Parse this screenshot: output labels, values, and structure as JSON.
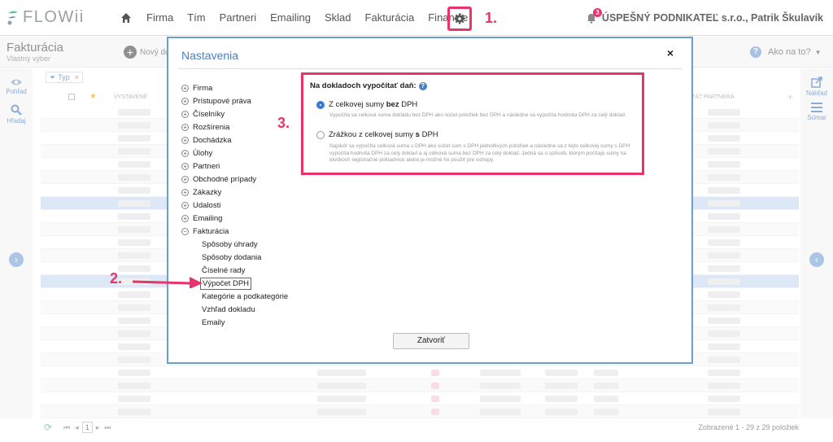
{
  "app": {
    "logo_text": "FLOWii"
  },
  "nav": {
    "items": [
      "Firma",
      "Tím",
      "Partneri",
      "Emailing",
      "Sklad",
      "Fakturácia",
      "Financie"
    ]
  },
  "user": {
    "company": "ÚSPEŠNÝ PODNIKATEĽ s.r.o., Patrik Škulavík",
    "notification_count": "3"
  },
  "annotations": {
    "step1": "1.",
    "step2": "2.",
    "step3": "3.",
    "accent_color": "#e8336b"
  },
  "subheader": {
    "title": "Fakturácia",
    "subtitle": "Vlastný výber",
    "new_label": "Nový do",
    "help_label": "Ako na to?"
  },
  "left_rail": {
    "view_label": "Pohľad",
    "search_label": "Hľadaj"
  },
  "right_rail": {
    "preview_label": "Náhľad",
    "summary_label": "Súmar"
  },
  "table": {
    "filter_chip": "Typ",
    "col_issued": "VYSTAVENÉ",
    "col_partner": "TÁT PARTNERA"
  },
  "footer": {
    "page": "1",
    "summary": "Zobrazené 1 - 29 z 29 položiek"
  },
  "modal": {
    "title": "Nastavenia",
    "close_symbol": "×",
    "tree": [
      {
        "label": "Firma",
        "expanded": false
      },
      {
        "label": "Prístupové práva",
        "expanded": false
      },
      {
        "label": "Číselníky",
        "expanded": false
      },
      {
        "label": "Rozšírenia",
        "expanded": false
      },
      {
        "label": "Dochádzka",
        "expanded": false
      },
      {
        "label": "Úlohy",
        "expanded": false
      },
      {
        "label": "Partneri",
        "expanded": false
      },
      {
        "label": "Obchodné prípady",
        "expanded": false
      },
      {
        "label": "Zákazky",
        "expanded": false
      },
      {
        "label": "Udalosti",
        "expanded": false
      },
      {
        "label": "Emailing",
        "expanded": false
      },
      {
        "label": "Fakturácia",
        "expanded": true
      }
    ],
    "sub_items": [
      "Spôsoby úhrady",
      "Spôsoby dodania",
      "Číselné rady",
      "Výpočet DPH",
      "Kategórie a podkategórie",
      "Vzhľad dokladu",
      "Emaily"
    ],
    "active_sub": "Výpočet DPH",
    "setting_header": "Na dokladoch vypočítať daň:",
    "option1_pre": "Z celkovej sumy ",
    "option1_bold": "bez",
    "option1_post": " DPH",
    "option1_desc": "Vypočíta sa celková suma dokladu bez DPH ako súčet položiek bez DPH a následne sa vypočíta hodnota DPH za celý doklad.",
    "option2_pre": "Zrážkou z celkovej sumy ",
    "option2_bold": "s",
    "option2_post": " DPH",
    "option2_desc": "Najskôr sa vypočíta celková suma s DPH ako súčet súm s DPH jednotlivých položiek a následne sa z tejto celkovej sumy s DPH vypočíta hodnota DPH za celý doklad a aj celková suma bez DPH za celý doklad. Jedná sa o spôsob, ktorým počítajú sumy na bločkoch registračné pokladnice alebo je možné ho použiť pre eshopy.",
    "selected_option": 1,
    "close_button": "Zatvoriť"
  }
}
